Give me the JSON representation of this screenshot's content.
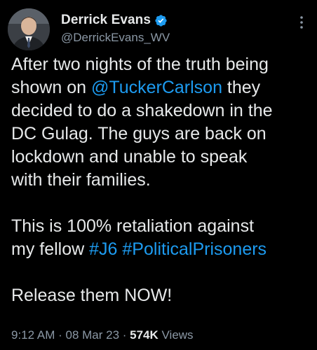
{
  "author": {
    "display_name": "Derrick Evans",
    "handle": "@DerrickEvans_WV",
    "avatar_icon": "profile-photo",
    "verified_icon": "verified-badge-icon",
    "verified_color": "#1d9bf0"
  },
  "more_icon": "more-options-icon",
  "tweet": {
    "p1_l1": "After two nights of the truth being",
    "p1_l2_a": "shown on ",
    "p1_l2_mention": "@TuckerCarlson",
    "p1_l2_b": " they",
    "p1_l3": "decided to do a shakedown in the",
    "p1_l4": "DC Gulag. The guys are back on",
    "p1_l5": "lockdown and unable to speak",
    "p1_l6": "with their families.",
    "p2_l1": "This is 100% retaliation against",
    "p2_l2_a": "my fellow ",
    "p2_l2_tag1": "#J6",
    "p2_l2_sp": " ",
    "p2_l2_tag2": "#PoliticalPrisoners",
    "p3_l1": "Release them NOW!"
  },
  "meta": {
    "time": "9:12 AM",
    "sep1": " · ",
    "date": "08 Mar 23",
    "sep2": " · ",
    "views_count": "574K",
    "views_label": " Views"
  },
  "colors": {
    "background": "#000000",
    "text": "#e7e9ea",
    "secondary": "#8b98a5",
    "link": "#1d9bf0"
  }
}
